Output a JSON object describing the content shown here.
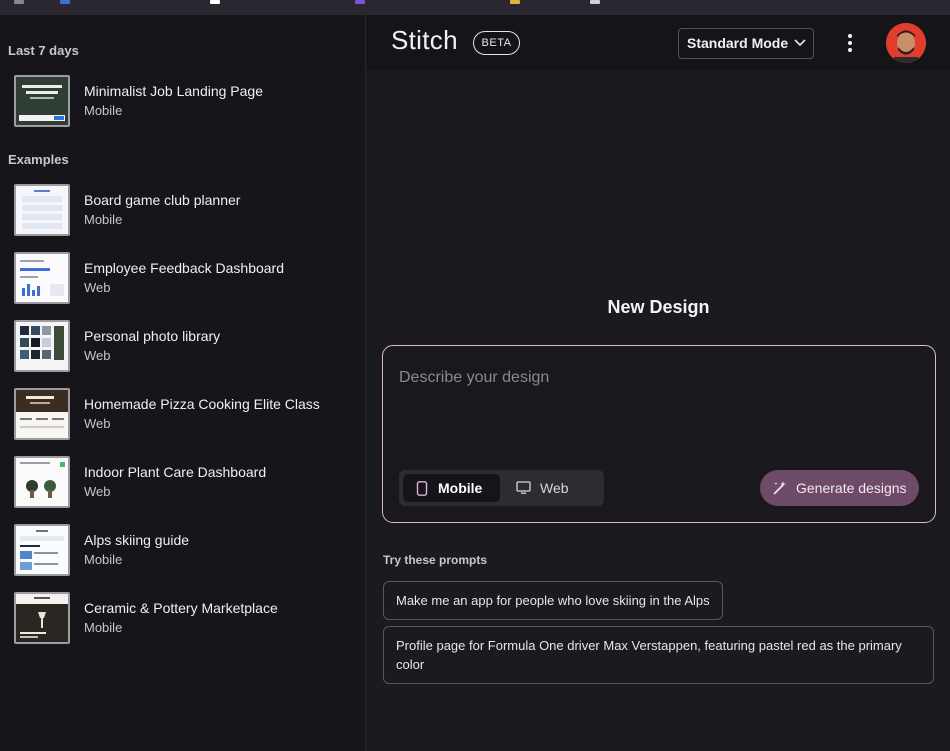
{
  "colors": {
    "accent": "#6d4a67",
    "prompt_border": "#d8b8d6",
    "sidebar_bg": "#161519",
    "main_bg": "#1b1a1f"
  },
  "sidebar": {
    "recent_label": "Last 7 days",
    "recent": [
      {
        "title": "Minimalist Job Landing Page",
        "sub": "Mobile"
      }
    ],
    "examples_label": "Examples",
    "examples": [
      {
        "title": "Board game club planner",
        "sub": "Mobile"
      },
      {
        "title": "Employee Feedback Dashboard",
        "sub": "Web"
      },
      {
        "title": "Personal photo library",
        "sub": "Web"
      },
      {
        "title": "Homemade Pizza Cooking Elite Class",
        "sub": "Web"
      },
      {
        "title": "Indoor Plant Care Dashboard",
        "sub": "Web"
      },
      {
        "title": "Alps skiing guide",
        "sub": "Mobile"
      },
      {
        "title": "Ceramic & Pottery Marketplace",
        "sub": "Mobile"
      }
    ]
  },
  "header": {
    "logo": "Stitch",
    "badge": "BETA",
    "mode": "Standard Mode",
    "icons": [
      "chevron-down-icon",
      "kebab-menu-icon",
      "user-avatar"
    ]
  },
  "main": {
    "title": "New Design",
    "prompt_placeholder": "Describe your design",
    "toggle": {
      "mobile": "Mobile",
      "web": "Web",
      "selected": "Mobile"
    },
    "generate": "Generate designs",
    "try_label": "Try these prompts",
    "prompts": [
      "Make me an app for people who love skiing in the Alps",
      "Profile page for Formula One driver Max Verstappen, featuring pastel red as the primary color"
    ]
  }
}
